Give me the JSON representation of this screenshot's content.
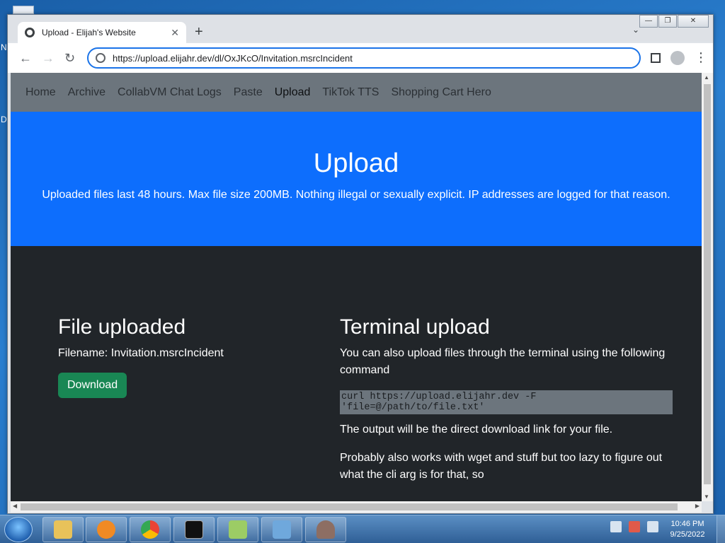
{
  "desktop": {
    "edge_letters": [
      "N",
      "D"
    ]
  },
  "browser": {
    "tab_title": "Upload - Elijah's Website",
    "tab_close": "✕",
    "new_tab": "+",
    "url": "https://upload.elijahr.dev/dl/OxJKcO/Invitation.msrcIncident",
    "back": "←",
    "forward": "→",
    "reload": "↻",
    "menu": "⋮",
    "tab_search": "⌄",
    "window_controls": {
      "minimize": "—",
      "restore": "❐",
      "close": "✕"
    }
  },
  "site": {
    "nav": [
      {
        "label": "Home",
        "active": false
      },
      {
        "label": "Archive",
        "active": false
      },
      {
        "label": "CollabVM Chat Logs",
        "active": false
      },
      {
        "label": "Paste",
        "active": false
      },
      {
        "label": "Upload",
        "active": true
      },
      {
        "label": "TikTok TTS",
        "active": false
      },
      {
        "label": "Shopping Cart Hero",
        "active": false
      }
    ],
    "hero": {
      "title": "Upload",
      "subtitle": "Uploaded files last 48 hours. Max file size 200MB. Nothing illegal or sexually explicit. IP addresses are logged for that reason."
    },
    "file": {
      "heading": "File uploaded",
      "filename": "Filename: Invitation.msrcIncident",
      "download_label": "Download"
    },
    "terminal": {
      "heading": "Terminal upload",
      "intro": "You can also upload files through the terminal using the following command",
      "command": "curl https://upload.elijahr.dev -F 'file=@/path/to/file.txt'",
      "output_note": "The output will be the direct download link for your file.",
      "wget_note": "Probably also works with wget and stuff but too lazy to figure out what the cli arg is for that, so"
    }
  },
  "taskbar": {
    "apps": [
      "explorer-icon",
      "media-player-icon",
      "chrome-icon",
      "cmd-icon",
      "notepad-plus-plus-icon",
      "control-panel-icon",
      "wireshark-icon"
    ],
    "time": "10:46 PM",
    "date": "9/25/2022"
  },
  "colors": {
    "hero_bg": "#0d6efd",
    "nav_bg": "#6c757d",
    "content_bg": "#212529",
    "download_btn": "#198754"
  }
}
